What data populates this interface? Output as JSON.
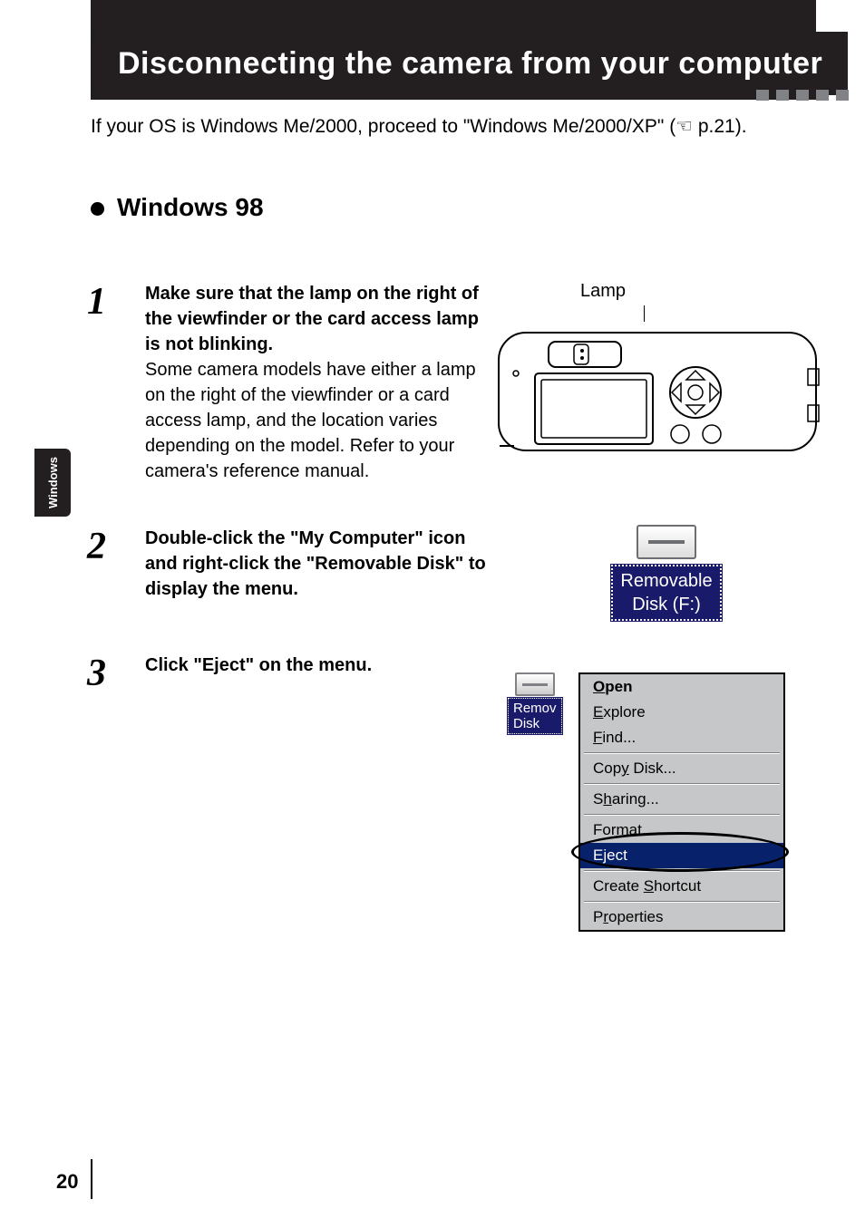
{
  "title": "Disconnecting the camera from your computer",
  "intro": {
    "line1_a": "If your OS is Windows Me/2000, proceed to \"Windows Me/2000/XP\" (",
    "line1_b": " p.21).",
    "hand_icon": "☞"
  },
  "section": {
    "heading": "Windows 98"
  },
  "side_tab": "Windows",
  "steps": {
    "s1": {
      "num": "1",
      "bold": "Make sure that the lamp on the right of the viewfinder or the card access lamp is not blinking.",
      "rest": "Some camera models have either a lamp on the right of the viewfinder or a card access lamp, and the location varies depending on the model. Refer to your camera's reference manual."
    },
    "s2": {
      "num": "2",
      "bold": "Double-click the \"My Computer\" icon and right-click the \"Removable Disk\" to display the menu."
    },
    "s3": {
      "num": "3",
      "bold": "Click \"Eject\" on the menu."
    }
  },
  "camera": {
    "lamp_label": "Lamp"
  },
  "removable_disk": {
    "label_line1": "Removable",
    "label_line2": "Disk (F:)"
  },
  "context_menu": {
    "sel_label_line1": "Remov",
    "sel_label_line2": "Disk",
    "items": {
      "open_pre": "O",
      "open_rest": "pen",
      "explore_pre": "E",
      "explore_rest": "xplore",
      "find_pre": "F",
      "find_rest": "ind...",
      "copy_pre": "Cop",
      "copy_u": "y",
      "copy_rest": " Disk...",
      "sharing_pre": "S",
      "sharing_u": "h",
      "sharing_rest": "aring...",
      "format_pre": "For",
      "format_u": "m",
      "format_rest": "at...",
      "eject_pre": "E",
      "eject_u": "j",
      "eject_rest": "ect",
      "shortcut_pre": "Create ",
      "shortcut_u": "S",
      "shortcut_rest": "hortcut",
      "props_pre": "P",
      "props_u": "r",
      "props_rest": "operties"
    }
  },
  "page_number": "20"
}
